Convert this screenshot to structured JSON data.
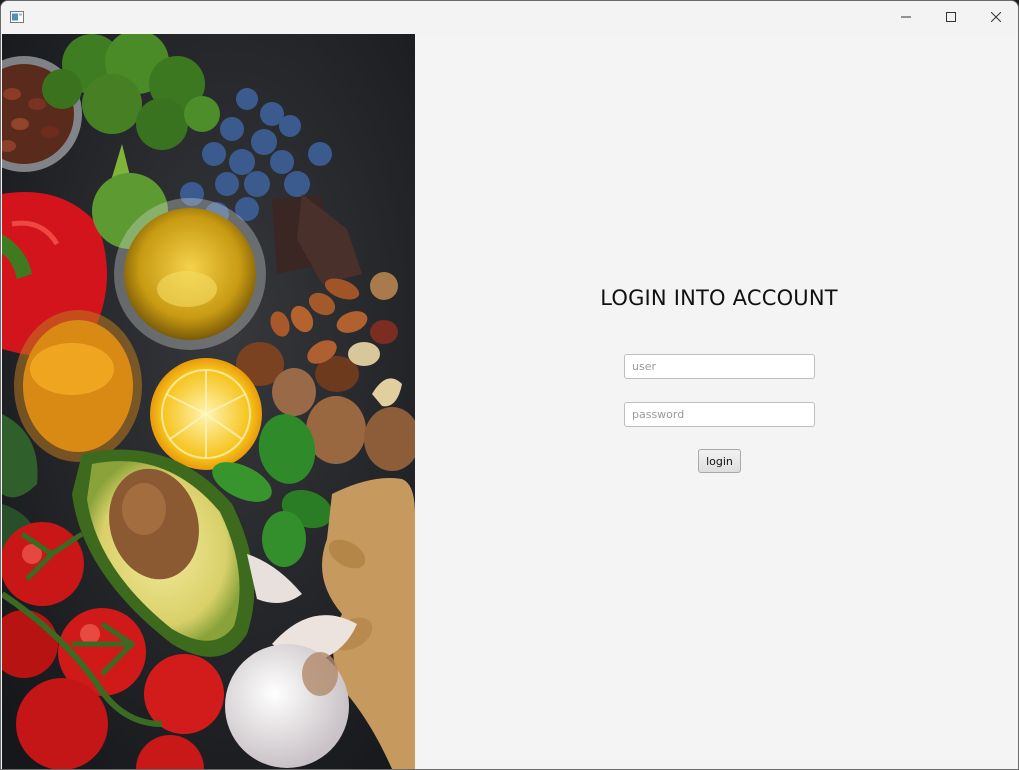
{
  "window": {
    "title": "",
    "controls": {
      "minimize_icon": "minimize-icon",
      "maximize_icon": "maximize-icon",
      "close_icon": "close-icon"
    }
  },
  "image_panel": {
    "subject": "healthy food ingredients",
    "items": [
      "beans",
      "broccoli",
      "blueberries",
      "dark chocolate",
      "red bell pepper",
      "olive oil",
      "turmeric",
      "almonds",
      "hazelnuts",
      "walnuts",
      "cashews",
      "pistachios",
      "lemon",
      "avocado",
      "basil",
      "tomatoes",
      "ginger",
      "garlic",
      "brussels sprout"
    ]
  },
  "login": {
    "title": "LOGIN INTO ACCOUNT",
    "user_placeholder": "user",
    "user_value": "",
    "password_placeholder": "password",
    "password_value": "",
    "button_label": "login"
  },
  "colors": {
    "window_bg": "#f3f3f3",
    "form_bg": "#f4f4f4",
    "image_bg": "#222326",
    "field_border": "#bfbfbf",
    "placeholder": "#9a9a9a"
  }
}
